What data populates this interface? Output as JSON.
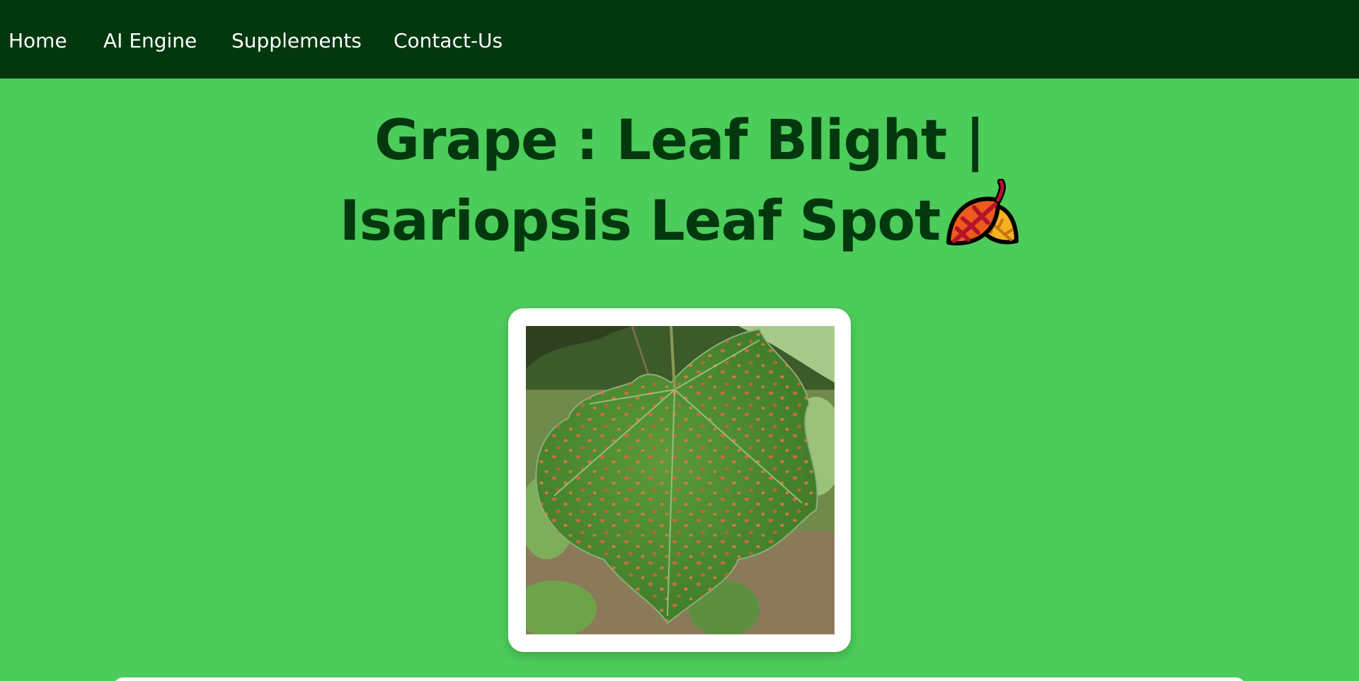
{
  "nav": {
    "items": [
      {
        "label": "Home"
      },
      {
        "label": "AI Engine"
      },
      {
        "label": "Supplements"
      },
      {
        "label": "Contact-Us"
      }
    ]
  },
  "page": {
    "title": "Grape : Leaf Blight | Isariopsis Leaf Spot",
    "title_icon": "fallen-leaf-icon"
  },
  "image": {
    "alt": "grape leaf with isariopsis leaf spot"
  },
  "colors": {
    "nav_bg": "#03380e",
    "page_bg": "#4ccc5a",
    "title": "#03380e",
    "card_bg": "#ffffff"
  }
}
